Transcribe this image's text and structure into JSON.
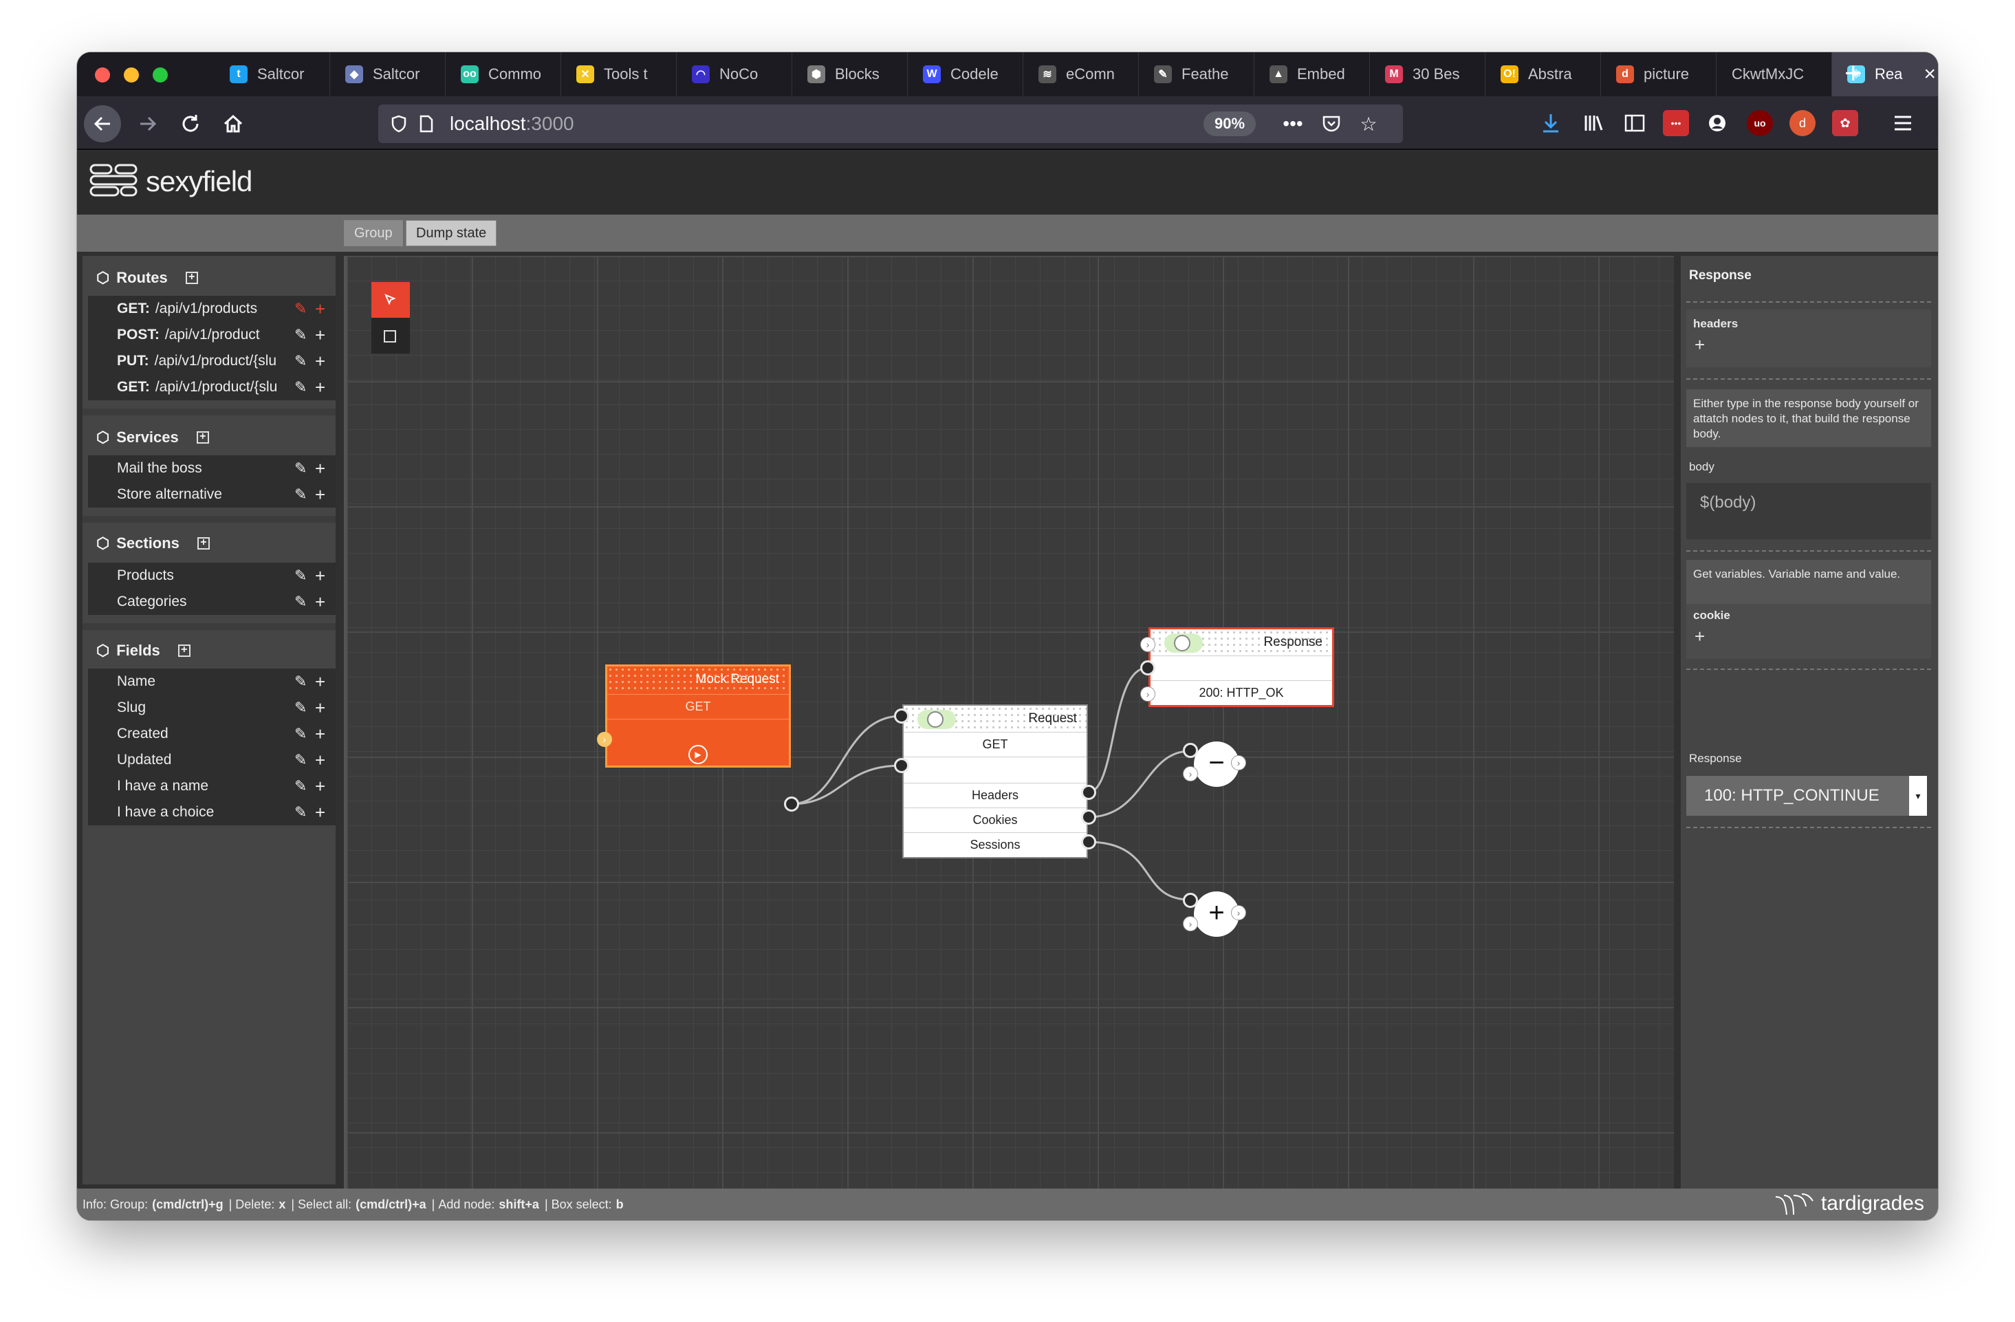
{
  "browser": {
    "tabs": [
      {
        "label": "Saltcor",
        "icon": "twitter-icon",
        "color": "#1da1f2",
        "glyph": "t"
      },
      {
        "label": "Saltcor",
        "icon": "hexagon-icon",
        "color": "#6b7bb8",
        "glyph": "◆"
      },
      {
        "label": "Commo",
        "icon": "commo-icon",
        "color": "#2ec4a6",
        "glyph": "oo"
      },
      {
        "label": "Tools t",
        "icon": "tools-icon",
        "color": "#f3c623",
        "glyph": "✕"
      },
      {
        "label": "NoCo",
        "icon": "noco-icon",
        "color": "#3b2fc9",
        "glyph": "◠"
      },
      {
        "label": "Blocks",
        "icon": "blocks-icon",
        "color": "#7a7a7a",
        "glyph": "⬢"
      },
      {
        "label": "Codele",
        "icon": "webflow-icon",
        "color": "#4353ff",
        "glyph": "W"
      },
      {
        "label": "eComn",
        "icon": "squarespace-icon",
        "color": "#555",
        "glyph": "≋"
      },
      {
        "label": "Feathe",
        "icon": "feather-icon",
        "color": "#555",
        "glyph": "✎"
      },
      {
        "label": "Embed",
        "icon": "triangle-icon",
        "color": "#555",
        "glyph": "▲"
      },
      {
        "label": "30 Bes",
        "icon": "mail-icon",
        "color": "#d93c5b",
        "glyph": "M"
      },
      {
        "label": "Abstra",
        "icon": "abstract-icon",
        "color": "#f5b400",
        "glyph": "O!"
      },
      {
        "label": "picture",
        "icon": "duckduckgo-icon",
        "color": "#de5833",
        "glyph": "d"
      },
      {
        "label": "CkwtMxJC",
        "icon": "",
        "color": "",
        "glyph": ""
      },
      {
        "label": "Rea",
        "icon": "react-icon",
        "color": "#61dafb",
        "glyph": "⚛"
      }
    ],
    "url_host": "localhost",
    "url_port": ":3000",
    "zoom": "90%"
  },
  "app": {
    "brand": "sexyfield",
    "toolbar": {
      "group": "Group",
      "dump_state": "Dump state"
    }
  },
  "sidebar": {
    "routes": {
      "title": "Routes",
      "items": [
        {
          "method": "GET:",
          "path": "/api/v1/products"
        },
        {
          "method": "POST:",
          "path": "/api/v1/product"
        },
        {
          "method": "PUT:",
          "path": "/api/v1/product/{slu"
        },
        {
          "method": "GET:",
          "path": "/api/v1/product/{slu"
        }
      ]
    },
    "services": {
      "title": "Services",
      "items": [
        "Mail the boss",
        "Store alternative"
      ]
    },
    "sections": {
      "title": "Sections",
      "items": [
        "Products",
        "Categories"
      ]
    },
    "fields": {
      "title": "Fields",
      "items": [
        "Name",
        "Slug",
        "Created",
        "Updated",
        "I have a name",
        "I have a choice"
      ]
    }
  },
  "canvas": {
    "mock_node": {
      "title": "Mock Request",
      "method": "GET"
    },
    "request_node": {
      "title": "Request",
      "method": "GET",
      "outputs": [
        "Headers",
        "Cookies",
        "Sessions"
      ]
    },
    "response_node": {
      "title": "Response",
      "status": "200: HTTP_OK"
    },
    "minus_node": {
      "symbol": "−"
    },
    "plus_node": {
      "symbol": "+"
    }
  },
  "inspector": {
    "title": "Response",
    "headers_label": "headers",
    "body_hint": "Either type in the response body yourself or attatch nodes to it, that build the response body.",
    "body_label": "body",
    "body_placeholder": "$(body)",
    "cookie_hint": "Get variables. Variable name and value.",
    "cookie_label": "cookie",
    "response_label": "Response",
    "response_value": "100: HTTP_CONTINUE"
  },
  "statusbar": {
    "info": "Info:",
    "group_label": "Group:",
    "group_key": "(cmd/ctrl)+g",
    "delete_label": "Delete:",
    "delete_key": "x",
    "selectall_label": "Select all:",
    "selectall_key": "(cmd/ctrl)+a",
    "addnode_label": "Add node:",
    "addnode_key": "shift+a",
    "boxselect_label": "Box select:",
    "boxselect_key": "b",
    "credit": "tardigrades"
  },
  "colors": {
    "accent": "#e8432f",
    "mock_node": "#f05a22",
    "toggle_on": "#d6f0c4"
  }
}
